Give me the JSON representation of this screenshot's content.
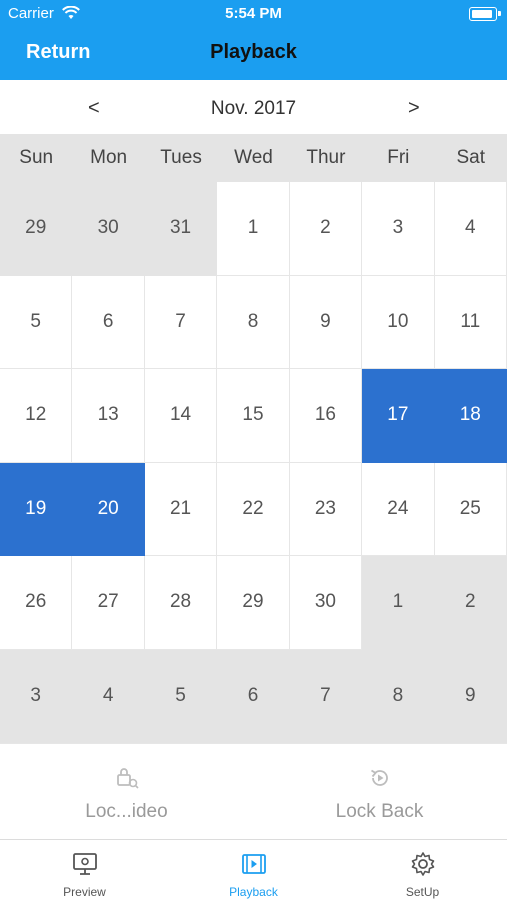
{
  "status": {
    "carrier": "Carrier",
    "time": "5:54 PM"
  },
  "nav": {
    "back_label": "Return",
    "title": "Playback"
  },
  "calendar": {
    "prev_label": "<",
    "next_label": ">",
    "month_label": "Nov. 2017",
    "weekdays": [
      "Sun",
      "Mon",
      "Tues",
      "Wed",
      "Thur",
      "Fri",
      "Sat"
    ],
    "days": [
      {
        "label": "29",
        "other": true
      },
      {
        "label": "30",
        "other": true
      },
      {
        "label": "31",
        "other": true
      },
      {
        "label": "1"
      },
      {
        "label": "2"
      },
      {
        "label": "3"
      },
      {
        "label": "4"
      },
      {
        "label": "5"
      },
      {
        "label": "6"
      },
      {
        "label": "7"
      },
      {
        "label": "8"
      },
      {
        "label": "9"
      },
      {
        "label": "10"
      },
      {
        "label": "11"
      },
      {
        "label": "12"
      },
      {
        "label": "13"
      },
      {
        "label": "14"
      },
      {
        "label": "15"
      },
      {
        "label": "16"
      },
      {
        "label": "17",
        "selected": true
      },
      {
        "label": "18",
        "selected": true
      },
      {
        "label": "19",
        "selected": true
      },
      {
        "label": "20",
        "selected": true
      },
      {
        "label": "21"
      },
      {
        "label": "22"
      },
      {
        "label": "23"
      },
      {
        "label": "24"
      },
      {
        "label": "25"
      },
      {
        "label": "26"
      },
      {
        "label": "27"
      },
      {
        "label": "28"
      },
      {
        "label": "29"
      },
      {
        "label": "30"
      },
      {
        "label": "1",
        "other": true
      },
      {
        "label": "2",
        "other": true
      },
      {
        "label": "3",
        "other": true
      },
      {
        "label": "4",
        "other": true
      },
      {
        "label": "5",
        "other": true
      },
      {
        "label": "6",
        "other": true
      },
      {
        "label": "7",
        "other": true
      },
      {
        "label": "8",
        "other": true
      },
      {
        "label": "9",
        "other": true
      }
    ]
  },
  "actions": {
    "lock_video_label": "Loc...ideo",
    "lock_back_label": "Lock Back"
  },
  "tabs": [
    {
      "label": "Preview",
      "icon": "monitor-icon"
    },
    {
      "label": "Playback",
      "icon": "film-icon",
      "active": true
    },
    {
      "label": "SetUp",
      "icon": "gear-icon"
    }
  ],
  "colors": {
    "header": "#1b9ef0",
    "selected": "#2c71cf",
    "other_month": "#e4e4e4"
  }
}
